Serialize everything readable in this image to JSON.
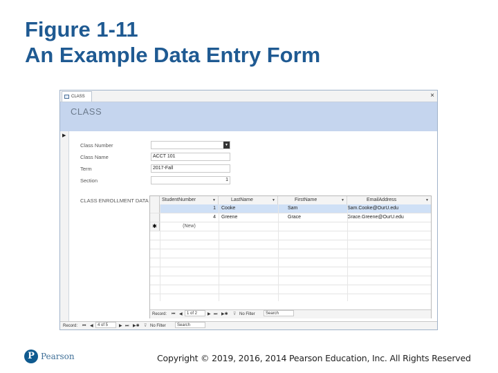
{
  "slide": {
    "title_line1": "Figure 1-11",
    "title_line2": "An Example Data Entry Form"
  },
  "window": {
    "tab_label": "CLASS",
    "tab_icon": "form-icon",
    "close_glyph": "×",
    "form_title": "CLASS",
    "record_selector_glyph": "▶"
  },
  "fields": {
    "class_number": {
      "label": "Class Number",
      "value": ""
    },
    "class_name": {
      "label": "Class Name",
      "value": "ACCT 101"
    },
    "term": {
      "label": "Term",
      "value": "2017-Fall"
    },
    "section": {
      "label": "Section",
      "value": "1"
    }
  },
  "subform": {
    "label": "CLASS ENROLLMENT DATA",
    "columns": [
      "StudentNumber",
      "LastName",
      "FirstName",
      "EmailAddress"
    ],
    "rows": [
      {
        "student_number": "1",
        "last_name": "Cooke",
        "first_name": "Sam",
        "email": "Sam.Cooke@OurU.edu",
        "selected": true
      },
      {
        "student_number": "4",
        "last_name": "Greene",
        "first_name": "Grace",
        "email": "Grace.Greene@OurU.edu",
        "selected": false
      }
    ],
    "new_row": {
      "marker": "✱",
      "label": "(New)"
    },
    "nav": {
      "record_label": "Record:",
      "first": "⏮",
      "prev": "◀",
      "position": "1 of 2",
      "next": "▶",
      "last": "⏭",
      "new": "▶✱",
      "no_filter": "No Filter",
      "search": "Search"
    }
  },
  "main_nav": {
    "record_label": "Record:",
    "first": "⏮",
    "prev": "◀",
    "position": "4 of 5",
    "next": "▶",
    "last": "⏭",
    "new": "▶✱",
    "no_filter": "No Filter",
    "search": "Search"
  },
  "footer": {
    "logo_letter": "P",
    "brand": "Pearson",
    "copyright": "Copyright © 2019, 2016, 2014 Pearson Education, Inc. All Rights Reserved"
  },
  "colors": {
    "title": "#1f5a92",
    "header_band": "#c5d5ee",
    "selected_row": "#cfe0f6",
    "logo": "#0f5a8f"
  }
}
